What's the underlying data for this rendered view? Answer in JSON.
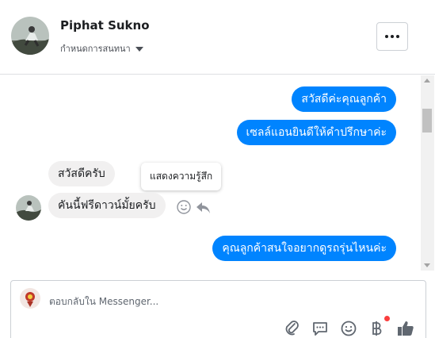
{
  "header": {
    "contact_name": "Piphat Sukno",
    "subtitle": "กำหนดการสนทนา",
    "more_icon": "more-horizontal-icon"
  },
  "messages": [
    {
      "direction": "outgoing",
      "text": "สวัสดีค่ะคุณลูกค้า"
    },
    {
      "direction": "outgoing",
      "text": "เซลล์แอนยินดีให้คำปรึกษาค่ะ"
    },
    {
      "direction": "incoming",
      "text": "สวัสดีครับ"
    },
    {
      "direction": "incoming",
      "text": "คันนี้ฟรีดาวน์มั้ยครับ"
    },
    {
      "direction": "outgoing",
      "text": "คุณลูกค้าสนใจอยากดูรถรุ่นไหนค่ะ"
    }
  ],
  "tooltip": "แสดงความรู้สึก",
  "message_actions": [
    "react-icon",
    "reply-icon"
  ],
  "composer": {
    "placeholder": "ตอบกลับใน Messenger...",
    "tools": [
      "attach-icon",
      "saved-replies-icon",
      "emoji-icon",
      "baht-icon",
      "like-icon"
    ]
  },
  "colors": {
    "outgoing_bubble": "#0084ff",
    "incoming_bubble": "#f1f0f0",
    "badge": "#fa3e3e",
    "like": "#606770"
  }
}
